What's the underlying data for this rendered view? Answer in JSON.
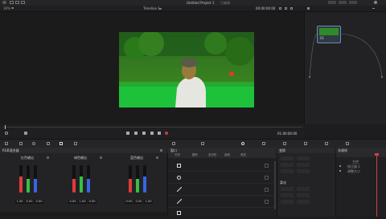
{
  "app": {
    "project_title": "Untitled Project 1",
    "project_status": "已编辑",
    "zoom": "39%",
    "timeline_name": "Timeline 1",
    "source_timecode": "00:00:00:00",
    "record_timecode": "01:00:00:00"
  },
  "clip_preview": {
    "label": "01"
  },
  "panels": {
    "wheels_title": "RGB混合器",
    "window_title": "窗口",
    "transform_title": "变换",
    "softness_title": "柔化",
    "keyframes_title": "关键帧",
    "keyframe_rows": [
      "主控",
      "校正器 1",
      "调整大小"
    ]
  },
  "channels": [
    {
      "label": "红色输出",
      "values": [
        "1.00",
        "0.00",
        "0.00"
      ],
      "levels": [
        0.6,
        0.0,
        0.0
      ]
    },
    {
      "label": "绿色输出",
      "values": [
        "0.00",
        "1.00",
        "0.00"
      ],
      "levels": [
        0.0,
        0.6,
        0.0
      ]
    },
    {
      "label": "蓝色输出",
      "values": [
        "0.00",
        "0.00",
        "1.00"
      ],
      "levels": [
        0.0,
        0.0,
        0.6
      ]
    }
  ],
  "window_tools": [
    "方形窗口",
    "圆形窗口",
    "多边形窗口",
    "曲线窗口",
    "渐变窗口"
  ],
  "window_header_labels": [
    "方形",
    "圆形",
    "多边形",
    "曲线",
    "渐变"
  ],
  "colors": {
    "accent_red": "#e03a3a",
    "accent_green": "#35c04a",
    "accent_blue": "#3a63e6",
    "playhead": "#d04040",
    "node_border": "#6b8db0"
  }
}
